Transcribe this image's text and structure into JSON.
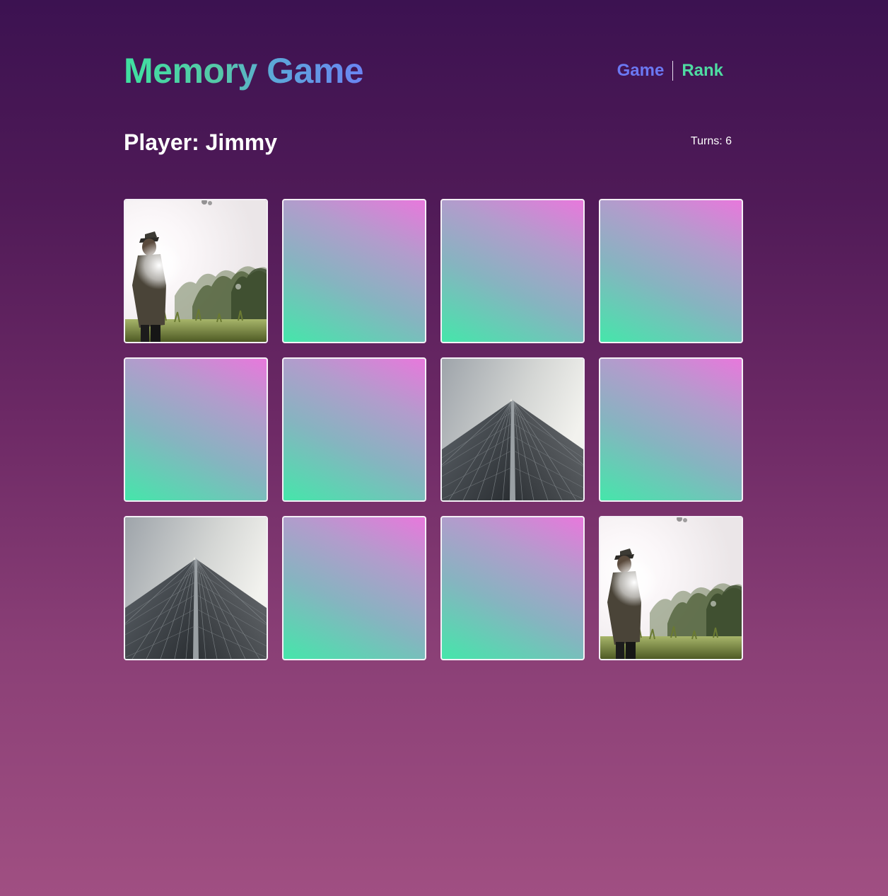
{
  "header": {
    "title": "Memory Game",
    "nav": {
      "game": "Game",
      "rank": "Rank"
    }
  },
  "status": {
    "player": "Player: Jimmy",
    "turns": "Turns: 6"
  },
  "board": {
    "rows": 3,
    "cols": 4,
    "cards": [
      {
        "state": "face-up",
        "image": "man-in-sunlit-field-photo"
      },
      {
        "state": "face-down",
        "image": ""
      },
      {
        "state": "face-down",
        "image": ""
      },
      {
        "state": "face-down",
        "image": ""
      },
      {
        "state": "face-down",
        "image": ""
      },
      {
        "state": "face-down",
        "image": ""
      },
      {
        "state": "face-up",
        "image": "skyscraper-looking-up-photo"
      },
      {
        "state": "face-down",
        "image": ""
      },
      {
        "state": "face-up",
        "image": "skyscraper-looking-up-photo"
      },
      {
        "state": "face-down",
        "image": ""
      },
      {
        "state": "face-down",
        "image": ""
      },
      {
        "state": "face-up",
        "image": "man-in-sunlit-field-photo"
      }
    ]
  },
  "colors": {
    "card_back_top": "#e878dc",
    "card_back_bottom": "#45e6aa",
    "title_gradient_start": "#3fe0a0",
    "title_gradient_end": "#6a84f4",
    "nav_game": "#6b78f2",
    "nav_rank": "#4fdba2"
  }
}
